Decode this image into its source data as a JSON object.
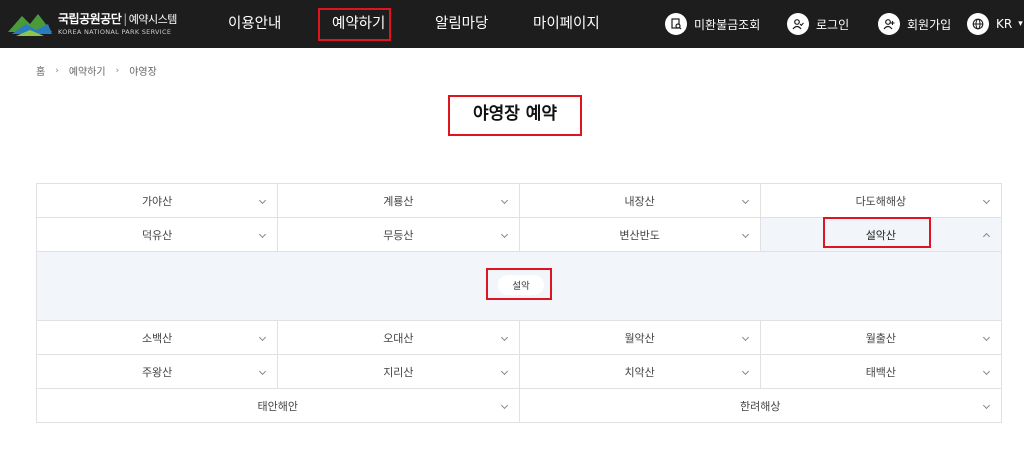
{
  "header": {
    "logo_title": "국립공원공단",
    "logo_subtitle": "예약시스템",
    "logo_english": "KOREA NATIONAL PARK SERVICE",
    "nav": [
      "이용안내",
      "예약하기",
      "알림마당",
      "마이페이지"
    ],
    "utility": {
      "unpaid_lookup": "미환불금조회",
      "login": "로그인",
      "signup": "회원가입",
      "language": "KR"
    }
  },
  "breadcrumb": [
    "홈",
    "예약하기",
    "야영장"
  ],
  "page_title": "야영장 예약",
  "parks": {
    "row1": [
      "가야산",
      "계룡산",
      "내장산",
      "다도해해상"
    ],
    "row2": [
      "덕유산",
      "무등산",
      "변산반도",
      "설악산"
    ],
    "expanded_sub": [
      "설악"
    ],
    "row3": [
      "소백산",
      "오대산",
      "월악산",
      "월출산"
    ],
    "row4": [
      "주왕산",
      "지리산",
      "치악산",
      "태백산"
    ],
    "row5": [
      "태안해안",
      "한려해상"
    ]
  },
  "colors": {
    "header_bg": "#1d1d1d",
    "highlight": "#e0141e",
    "panel_bg": "#f2f5f9"
  }
}
